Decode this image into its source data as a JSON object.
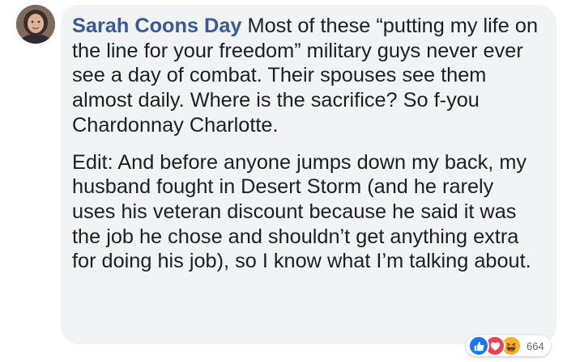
{
  "comment": {
    "author": "Sarah Coons Day",
    "paragraphs": [
      " Most of these “putting my life on the line for your freedom” military guys never ever see a day of combat. Their spouses see them almost daily. Where is the sacrifice? So f-you Chardonnay Charlotte.",
      "Edit: And before anyone jumps down my back, my husband fought in Desert Storm (and he rarely uses his veteran discount because he said it was the job he chose and shouldn’t get anything extra for doing his job), so I know what I’m talking about."
    ]
  },
  "reactions": {
    "icons": [
      "like-icon",
      "love-icon",
      "haha-icon"
    ],
    "count": "664",
    "colors": {
      "like": "#1877f2",
      "love": "#f33e58",
      "haha": "#f7b125"
    }
  },
  "colors": {
    "author_link": "#385898",
    "bubble_bg": "#f2f3f5",
    "text": "#1c1e21"
  }
}
